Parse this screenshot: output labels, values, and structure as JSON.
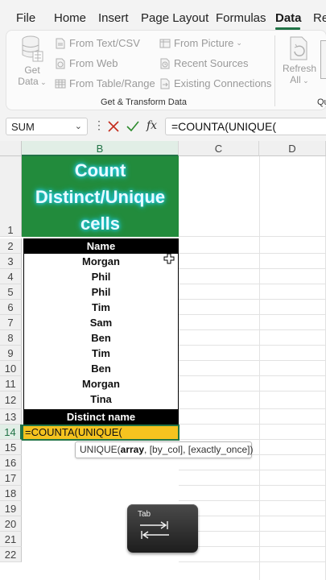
{
  "ribbon_tabs": [
    "File",
    "Home",
    "Insert",
    "Page Layout",
    "Formulas",
    "Data",
    "Re"
  ],
  "active_tab": "Data",
  "get_transform": {
    "get_data_label": "Get Data",
    "get_data_line1": "Get",
    "get_data_line2": "Data",
    "from_text_csv": "From Text/CSV",
    "from_web": "From Web",
    "from_table_range": "From Table/Range",
    "from_picture": "From Picture",
    "recent_sources": "Recent Sources",
    "existing_connections": "Existing Connections",
    "group_label": "Get & Transform Data"
  },
  "queries": {
    "refresh_line1": "Refresh",
    "refresh_line2": "All",
    "group_label_partial": "Qu"
  },
  "formula_bar": {
    "name_box": "SUM",
    "fx_label": "fx",
    "formula": "=COUNTA(UNIQUE("
  },
  "columns": [
    "B",
    "C",
    "D"
  ],
  "rows": [
    "1",
    "2",
    "3",
    "4",
    "5",
    "6",
    "7",
    "8",
    "9",
    "10",
    "11",
    "12",
    "13",
    "14",
    "15",
    "16",
    "17",
    "18",
    "19",
    "20",
    "21",
    "22"
  ],
  "sheet": {
    "title": "Count Distinct/Unique cells",
    "name_header": "Name",
    "names": [
      "Morgan",
      "Phil",
      "Phil",
      "Tim",
      "Sam",
      "Ben",
      "Tim",
      "Ben",
      "Morgan",
      "Tina"
    ],
    "distinct_header": "Distinct name",
    "active_cell_value": "=COUNTA(UNIQUE("
  },
  "tooltip": {
    "fn": "UNIQUE(",
    "arg_bold": "array",
    "rest": ", [by_col], [exactly_once])"
  },
  "key_hint": {
    "label": "Tab"
  },
  "colors": {
    "excel_green": "#217346",
    "title_fill": "#228b3c",
    "title_glow": "#20d3ff",
    "active_cell_fill": "#f5c31f",
    "cancel_red": "#c42b1c",
    "enter_green": "#2e8b2e"
  },
  "icons": [
    "database-icon",
    "text-csv-icon",
    "web-icon",
    "table-icon",
    "picture-icon",
    "recent-sources-icon",
    "connections-icon",
    "refresh-icon",
    "cancel-icon",
    "enter-icon",
    "fx-icon",
    "tab-arrows-icon",
    "move-cursor-icon"
  ]
}
